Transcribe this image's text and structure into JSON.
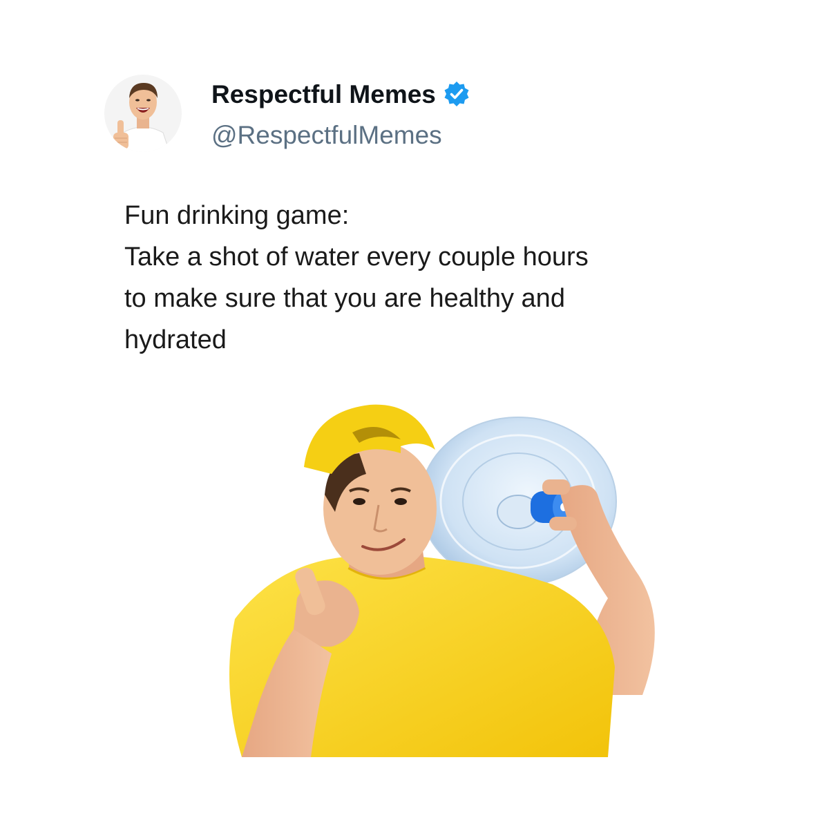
{
  "account": {
    "display_name": "Respectful Memes",
    "handle": "@RespectfulMemes",
    "verified": true,
    "verified_color": "#1d9bf0",
    "avatar_icon": "avatar-thumbs-up-man"
  },
  "tweet": {
    "lines": [
      "Fun drinking game:",
      "Take a shot of water every couple hours",
      "to make sure that you are healthy and",
      "hydrated"
    ]
  },
  "media": {
    "description_icon": "man-yellow-cap-water-jug-illustration",
    "colors": {
      "shirt": "#f7d21a",
      "cap": "#f5cf14",
      "bottle": "#cfe3f5",
      "bottle_cap": "#1d6fe0"
    }
  }
}
